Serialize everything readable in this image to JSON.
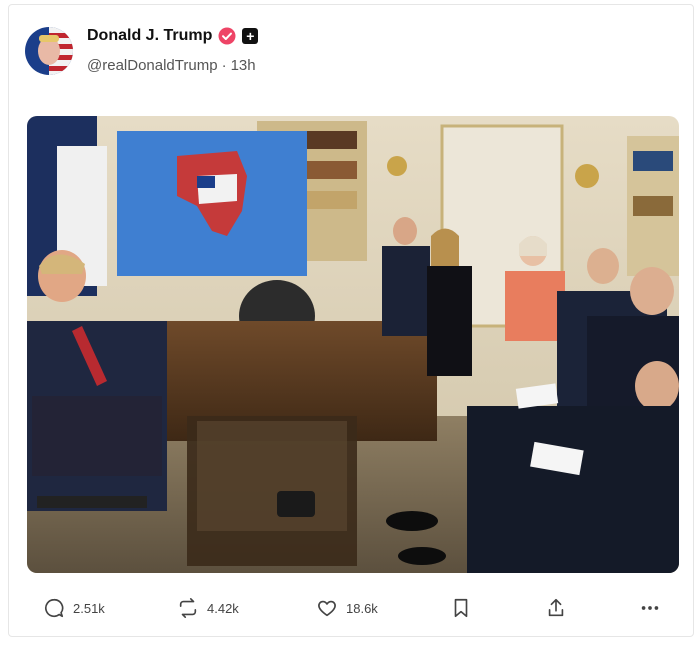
{
  "post": {
    "display_name": "Donald J. Trump",
    "handle": "@realDonaldTrump",
    "separator": "·",
    "time_ago": "13h",
    "plus_badge": "+"
  },
  "media": {
    "description_icon": "photo"
  },
  "actions": {
    "replies": "2.51k",
    "reposts": "4.42k",
    "likes": "18.6k"
  },
  "colors": {
    "verified": "#ee4466",
    "text": "#111111",
    "muted": "#555555"
  }
}
